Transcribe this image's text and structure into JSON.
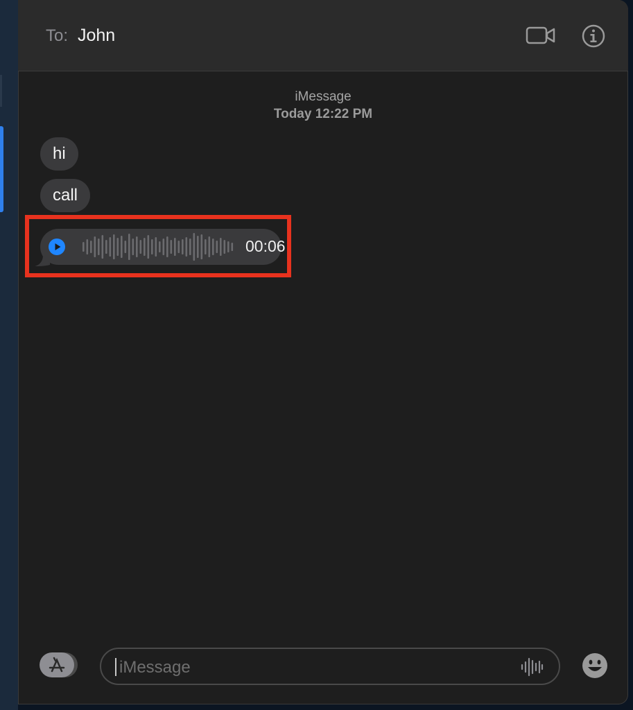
{
  "header": {
    "to_label": "To:",
    "recipient": "John",
    "icons": [
      "video-camera-icon",
      "info-icon"
    ]
  },
  "thread": {
    "service": "iMessage",
    "timestamp": "Today 12:22 PM",
    "messages": [
      {
        "type": "text",
        "text": "hi"
      },
      {
        "type": "text",
        "text": "call"
      },
      {
        "type": "audio",
        "duration": "00:06",
        "icon": "play-icon"
      }
    ]
  },
  "composer": {
    "placeholder": "iMessage",
    "icons": [
      "app-store-icon",
      "audio-waveform-icon",
      "emoji-icon"
    ]
  },
  "colors": {
    "accent": "#1f86ff",
    "highlight": "#e8321e",
    "bubble": "#3a3a3c",
    "background": "#1e1e1e"
  }
}
